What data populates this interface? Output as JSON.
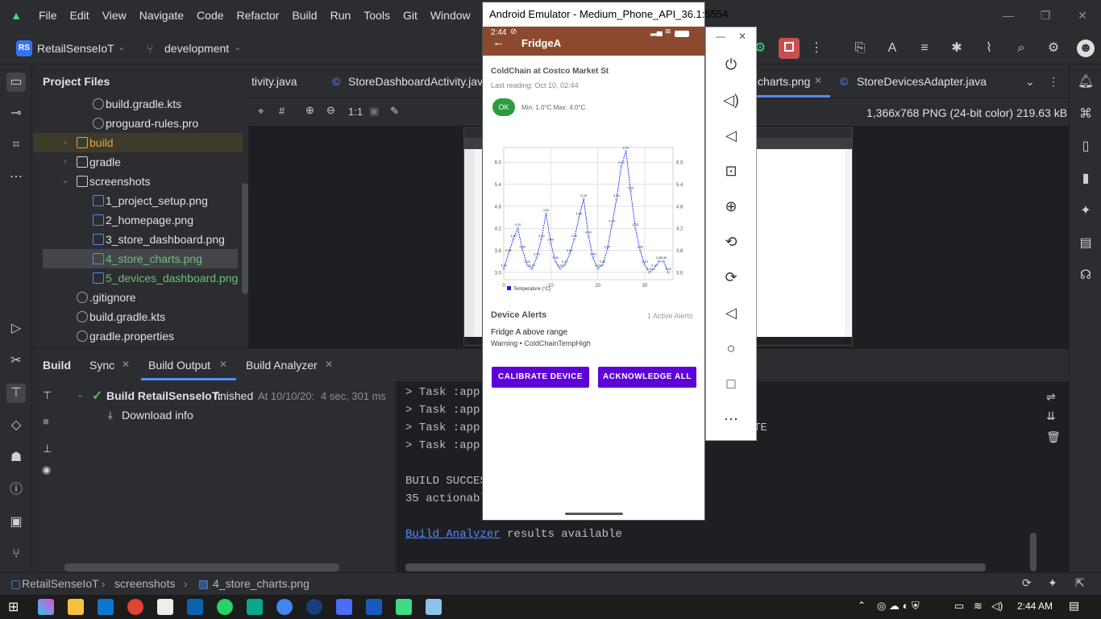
{
  "menubar": {
    "items": [
      "File",
      "Edit",
      "View",
      "Navigate",
      "Code",
      "Refactor",
      "Build",
      "Run",
      "Tools",
      "Git",
      "Window",
      "Help"
    ]
  },
  "toolbar": {
    "project_initials": "RS",
    "project_name": "RetailSenseIoT",
    "branch": "development"
  },
  "project_panel": {
    "title": "Project Files",
    "items": [
      {
        "label": "build.gradle.kts",
        "icon": "gradle-file-icon",
        "indent": 2
      },
      {
        "label": "proguard-rules.pro",
        "icon": "text-file-icon",
        "indent": 2
      },
      {
        "label": "build",
        "icon": "folder-icon",
        "indent": 1,
        "collapsed": true,
        "highlight": true
      },
      {
        "label": "gradle",
        "icon": "folder-icon",
        "indent": 1,
        "collapsed": true
      },
      {
        "label": "screenshots",
        "icon": "folder-icon",
        "indent": 1,
        "expanded": true
      },
      {
        "label": "1_project_setup.png",
        "icon": "image-file-icon",
        "indent": 2
      },
      {
        "label": "2_homepage.png",
        "icon": "image-file-icon",
        "indent": 2
      },
      {
        "label": "3_store_dashboard.png",
        "icon": "image-file-icon",
        "indent": 2
      },
      {
        "label": "4_store_charts.png",
        "icon": "image-file-icon",
        "indent": 2,
        "selected": true,
        "green": true
      },
      {
        "label": "5_devices_dashboard.png",
        "icon": "image-file-icon",
        "indent": 2,
        "green": true
      },
      {
        "label": ".gitignore",
        "icon": "ignore-file-icon",
        "indent": 1
      },
      {
        "label": "build.gradle.kts",
        "icon": "gradle-file-icon",
        "indent": 1
      },
      {
        "label": "gradle.properties",
        "icon": "settings-file-icon",
        "indent": 1
      }
    ]
  },
  "editor": {
    "tabs": [
      {
        "label": "tivity.java"
      },
      {
        "label": "StoreDashboardActivity.java"
      },
      {
        "label": "charts.png",
        "active": true
      },
      {
        "label": "StoreDevicesAdapter.java"
      }
    ],
    "image_zoom_label": "1:1",
    "image_info": "1,366x768 PNG (24-bit color) 219.63 kB"
  },
  "bottom": {
    "tabs": [
      "Build",
      "Sync",
      "Build Output",
      "Build Analyzer"
    ],
    "build_title": "Build RetailSenseIoT:",
    "build_status": "finished",
    "build_time": "At 10/10/20:",
    "build_duration": "4 sec, 301 ms",
    "download": "Download info",
    "console": [
      "> Task :app:",
      "> Task :app:",
      "> Task :app:",
      "> Task :app:",
      "",
      "BUILD SUCCES",
      "35 actionabl",
      "",
      "results available"
    ],
    "console_suffix": "TE",
    "console_link": "Build Analyzer"
  },
  "statusbar": {
    "crumbs": [
      "RetailSenseIoT",
      "screenshots",
      "4_store_charts.png"
    ]
  },
  "taskbar": {
    "time": "2:44 AM"
  },
  "emulator": {
    "title": "Android Emulator - Medium_Phone_API_36.1:5554",
    "status_time": "2:44",
    "app_title": "FridgeA",
    "subtitle": "ColdChain at Costco Market St",
    "last_reading": "Last reading: Oct 10, 02:44",
    "ok_badge": "OK",
    "range": "Min: 1.0°C Max: 4.0°C",
    "alerts_title": "Device Alerts",
    "alerts_count": "1 Active Alerts",
    "alert_title": "Fridge A above range",
    "alert_sub": "Warning • ColdChainTempHigh",
    "btn_calibrate": "CALIBRATE DEVICE",
    "btn_ack": "ACKNOWLEDGE ALL"
  },
  "chart_data": {
    "type": "line",
    "title": "",
    "xlabel": "",
    "ylabel": "",
    "legend": "Temperature (°C)",
    "legend_position": "bottom-left",
    "color": "#1a1aff",
    "xlim": [
      0,
      36
    ],
    "ylim": [
      2.8,
      6.4
    ],
    "xticks": [
      0,
      10,
      20,
      30
    ],
    "yticks": [
      3.0,
      3.6,
      4.2,
      4.8,
      5.4,
      6.0
    ],
    "x": [
      0,
      1,
      2,
      3,
      4,
      5,
      6,
      7,
      8,
      9,
      10,
      11,
      12,
      13,
      14,
      15,
      16,
      17,
      18,
      19,
      20,
      21,
      22,
      23,
      24,
      25,
      26,
      27,
      28,
      29,
      30,
      31,
      32,
      33,
      34,
      35
    ],
    "y": [
      3.1,
      3.5,
      3.9,
      4.2,
      3.6,
      3.2,
      3.1,
      3.4,
      3.9,
      4.6,
      3.8,
      3.3,
      3.1,
      3.2,
      3.5,
      3.9,
      4.5,
      5.0,
      4.0,
      3.4,
      3.1,
      3.2,
      3.6,
      4.3,
      5.0,
      5.9,
      6.3,
      5.2,
      4.2,
      3.6,
      3.2,
      3.0,
      3.1,
      3.3,
      3.3,
      3.0
    ]
  }
}
